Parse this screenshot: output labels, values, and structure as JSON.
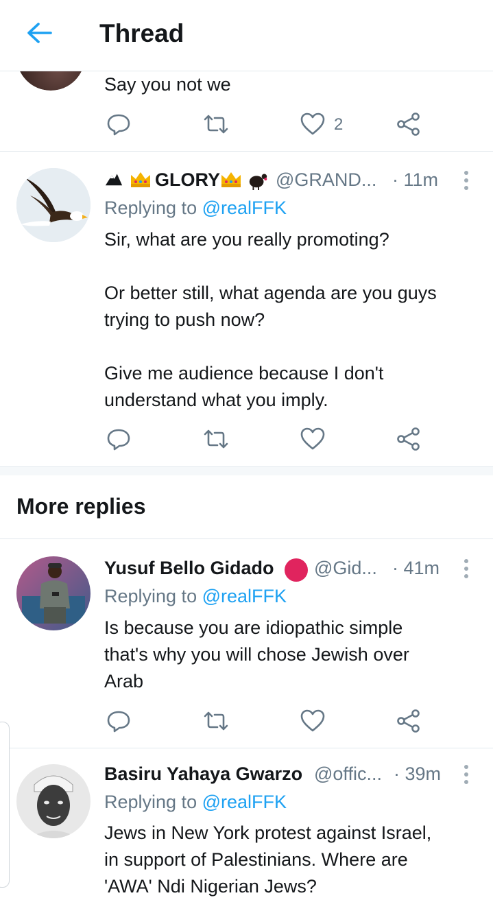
{
  "header": {
    "title": "Thread"
  },
  "tweet_prev": {
    "text": "Say you not we",
    "like_count": "2"
  },
  "tweet_glory": {
    "name_text": "GLORY",
    "handle": "@GRAND...",
    "time": "· 11m",
    "replying_prefix": "Replying to",
    "replying_to": "@realFFK",
    "p1": "Sir, what are you really promoting?",
    "p2a": "Or better still, what agenda are you guys",
    "p2b": "trying to push now?",
    "p3a": "Give me audience because I don't",
    "p3b": "understand what you imply."
  },
  "more_replies": {
    "heading": "More replies"
  },
  "tweet_yusuf": {
    "name": "Yusuf Bello Gidado",
    "handle": "@Gid...",
    "time": "· 41m",
    "replying_prefix": "Replying to",
    "replying_to": "@realFFK",
    "l1": "Is because you are idiopathic simple",
    "l2": "that's why you will chose Jewish over",
    "l3": "Arab"
  },
  "tweet_basiru": {
    "name": "Basiru Yahaya Gwarzo",
    "handle": "@offic...",
    "time": "· 39m",
    "replying_prefix": "Replying to",
    "replying_to": "@realFFK",
    "l1": "Jews in New York protest against Israel,",
    "l2": "in support of Palestinians. Where are",
    "l3": "'AWA' Ndi Nigerian Jews?"
  },
  "colors": {
    "accent": "#1da1f2",
    "text": "#14171a",
    "secondary": "#657786",
    "divider": "#e1e8ed",
    "red_badge": "#e0245e"
  }
}
